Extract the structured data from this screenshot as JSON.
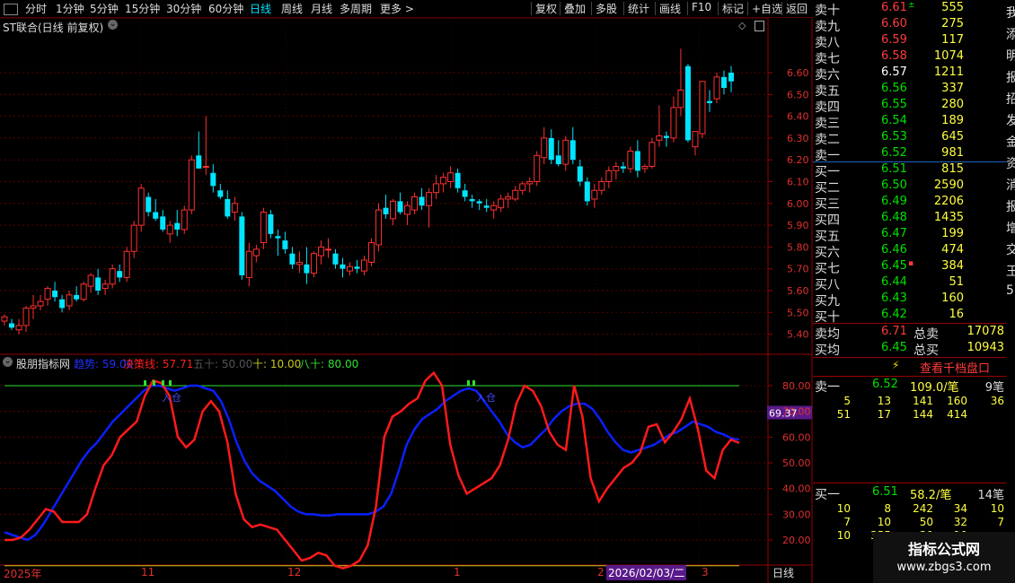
{
  "toolbar": {
    "periods": [
      "分时",
      "1分钟",
      "5分钟",
      "15分钟",
      "30分钟",
      "60分钟",
      "日线",
      "周线",
      "月线",
      "多周期",
      "更多 >"
    ],
    "active_period": "日线",
    "actions": [
      "复权",
      "叠加",
      "多股",
      "统计",
      "画线",
      "F10",
      "标记",
      "+自选",
      "返回"
    ]
  },
  "main_chart": {
    "title": "ST联合(日线 前复权)",
    "price_ticks": [
      "6.60",
      "6.50",
      "6.40",
      "6.30",
      "6.20",
      "6.10",
      "6.00",
      "5.90",
      "5.80",
      "5.70",
      "5.60",
      "5.50",
      "5.40"
    ]
  },
  "indicator": {
    "title": "股朋指标网",
    "legend": [
      {
        "label": "趋势: 59.00",
        "color": "#2030ff"
      },
      {
        "label": "决策线: 57.71",
        "color": "#ff2020"
      },
      {
        "label": "五十: 50.00",
        "color": "#555555"
      },
      {
        "label": "十: 10.00",
        "color": "#c8c820"
      },
      {
        "label": "八十: 80.00",
        "color": "#30e030"
      }
    ],
    "ticks": [
      "80.00",
      "70.00",
      "60.00",
      "50.00",
      "40.00",
      "30.00",
      "20.00"
    ],
    "current_value": "69.37",
    "annotation": "入仓",
    "trend_color": "#0a20ff",
    "decision_color": "#ff1a1a"
  },
  "time_axis": {
    "labels": [
      "2025年",
      "11",
      "12",
      "1",
      "2",
      "3"
    ],
    "cursor_date": "2026/02/03/二",
    "period_label": "日线"
  },
  "order_book": {
    "asks": [
      {
        "label": "卖十",
        "price": "6.61",
        "vol": "555",
        "mark": "±"
      },
      {
        "label": "卖九",
        "price": "6.60",
        "vol": "275"
      },
      {
        "label": "卖八",
        "price": "6.59",
        "vol": "117"
      },
      {
        "label": "卖七",
        "price": "6.58",
        "vol": "1074"
      },
      {
        "label": "卖六",
        "price": "6.57",
        "vol": "1211"
      },
      {
        "label": "卖五",
        "price": "6.56",
        "vol": "337"
      },
      {
        "label": "卖四",
        "price": "6.55",
        "vol": "280"
      },
      {
        "label": "卖三",
        "price": "6.54",
        "vol": "189"
      },
      {
        "label": "卖二",
        "price": "6.53",
        "vol": "645"
      },
      {
        "label": "卖一",
        "price": "6.52",
        "vol": "981"
      }
    ],
    "bids": [
      {
        "label": "买一",
        "price": "6.51",
        "vol": "815"
      },
      {
        "label": "买二",
        "price": "6.50",
        "vol": "2590"
      },
      {
        "label": "买三",
        "price": "6.49",
        "vol": "2206"
      },
      {
        "label": "买四",
        "price": "6.48",
        "vol": "1435"
      },
      {
        "label": "买五",
        "price": "6.47",
        "vol": "199"
      },
      {
        "label": "买六",
        "price": "6.46",
        "vol": "474"
      },
      {
        "label": "买七",
        "price": "6.45",
        "vol": "384",
        "mark": "▪"
      },
      {
        "label": "买八",
        "price": "6.44",
        "vol": "51"
      },
      {
        "label": "买九",
        "price": "6.43",
        "vol": "160"
      },
      {
        "label": "买十",
        "price": "6.42",
        "vol": "16"
      }
    ],
    "summary": [
      {
        "label": "卖均",
        "price": "6.71",
        "label2": "总卖",
        "vol": "17078"
      },
      {
        "label": "买均",
        "price": "6.45",
        "label2": "总买",
        "vol": "10943"
      }
    ],
    "view_1000": "查看千档盘口",
    "sell1_detail": {
      "label": "卖一",
      "price": "6.52",
      "avg": "109.0/笔",
      "count": "9笔",
      "rows": [
        [
          "5",
          "13",
          "141",
          "160",
          "36"
        ],
        [
          "51",
          "17",
          "144",
          "414",
          ""
        ]
      ]
    },
    "buy1_detail": {
      "label": "买一",
      "price": "6.51",
      "avg": "58.2/笔",
      "count": "14笔",
      "rows": [
        [
          "10",
          "8",
          "242",
          "34",
          "10"
        ],
        [
          "7",
          "10",
          "50",
          "32",
          "7"
        ],
        [
          "10",
          "355",
          "30",
          "10",
          ""
        ]
      ]
    },
    "right_strip": [
      "我",
      "添",
      "明",
      "报",
      "招",
      "发",
      "金",
      "资",
      "消",
      "报",
      "增",
      "交",
      "王",
      "5"
    ]
  },
  "watermark": {
    "title": "指标公式网",
    "url": "www.zbgs3.com"
  }
}
